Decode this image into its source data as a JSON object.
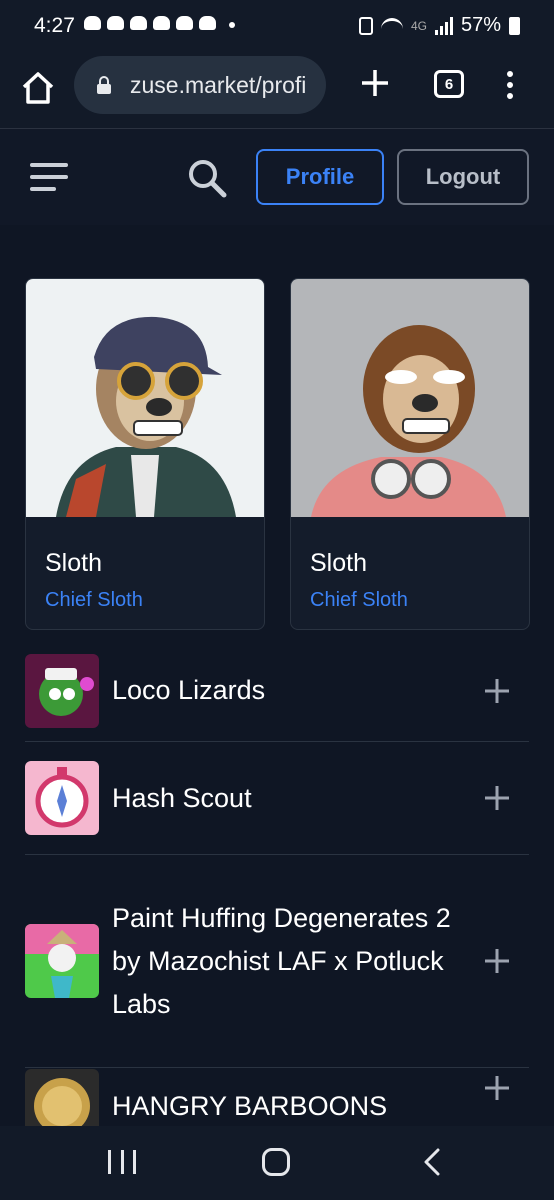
{
  "status_bar": {
    "time": "4:27",
    "network": "4G",
    "battery": "57%"
  },
  "browser": {
    "url": "zuse.market/profi",
    "tab_count": "6"
  },
  "header": {
    "profile_label": "Profile",
    "logout_label": "Logout"
  },
  "cards": [
    {
      "name": "Sloth",
      "role": "Chief Sloth"
    },
    {
      "name": "Sloth",
      "role": "Chief Sloth"
    }
  ],
  "collections": [
    {
      "label": "Loco Lizards"
    },
    {
      "label": "Hash Scout"
    },
    {
      "label": "Paint Huffing Degenerates 2 by Mazochist LAF x Potluck Labs"
    },
    {
      "label": "HANGRY BARBOONS"
    }
  ],
  "colors": {
    "background": "#0f1624",
    "accent": "#3b82f6",
    "card_border": "#2a3341"
  },
  "icons": [
    "home-icon",
    "lock-icon",
    "plus-icon",
    "tabs-icon",
    "more-vert-icon",
    "hamburger-icon",
    "search-icon",
    "add-icon",
    "recents-icon",
    "home-nav-icon",
    "back-icon"
  ]
}
